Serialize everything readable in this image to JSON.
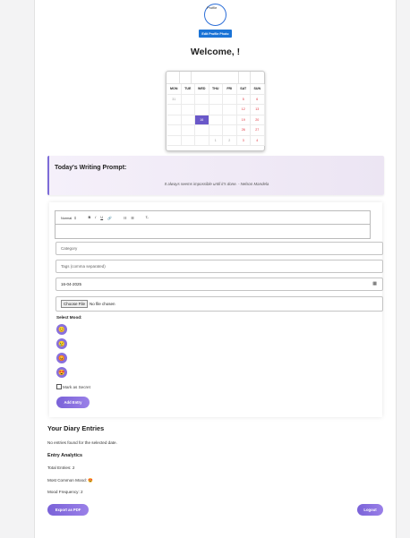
{
  "profile": {
    "photo_alt": "Profile",
    "edit_button": "Edit Profile Photo"
  },
  "welcome": "Welcome, !",
  "calendar": {
    "weekdays": [
      "MON",
      "TUE",
      "WED",
      "THU",
      "FRI",
      "SAT",
      "SUN"
    ],
    "weeks": [
      [
        "31",
        "",
        "",
        "",
        "",
        "5",
        "6"
      ],
      [
        "",
        "",
        "",
        "",
        "",
        "12",
        "13"
      ],
      [
        "",
        "",
        "16",
        "",
        "",
        "19",
        "20"
      ],
      [
        "",
        "",
        "",
        "",
        "",
        "26",
        "27"
      ],
      [
        "",
        "",
        "",
        "1",
        "2",
        "3",
        "4"
      ]
    ],
    "selected_day": "16"
  },
  "prompt": {
    "title": "Today's Writing Prompt:",
    "quote": "It always seems impossible until it's done. - Nelson Mandela"
  },
  "editor": {
    "format_select": "Normal",
    "buttons": [
      "B",
      "I",
      "U",
      "🔗",
      "☷",
      "☰",
      "T̶"
    ]
  },
  "form": {
    "category_placeholder": "Category",
    "tags_placeholder": "Tags (comma separated)",
    "date_value": "16-04-2025",
    "file_button": "Choose File",
    "file_status": "No file chosen",
    "mood_label": "Select Mood:",
    "moods": [
      "😊",
      "😢",
      "😡",
      "😍"
    ],
    "secret_label": "Mark as Secret",
    "add_button": "Add Entry"
  },
  "entries": {
    "title": "Your Diary Entries",
    "empty_text": "No entries found for the selected date.",
    "analytics_title": "Entry Analytics",
    "total_entries": "Total Entries: 2",
    "most_common_mood": "Most Common Mood: 😍",
    "mood_frequency": "Mood Frequency: 2"
  },
  "actions": {
    "export": "Export as PDF",
    "logout": "Logout"
  },
  "colors": {
    "accent": "#7a62d8",
    "edit_button": "#1a73d6",
    "weekend": "#e0303a"
  }
}
